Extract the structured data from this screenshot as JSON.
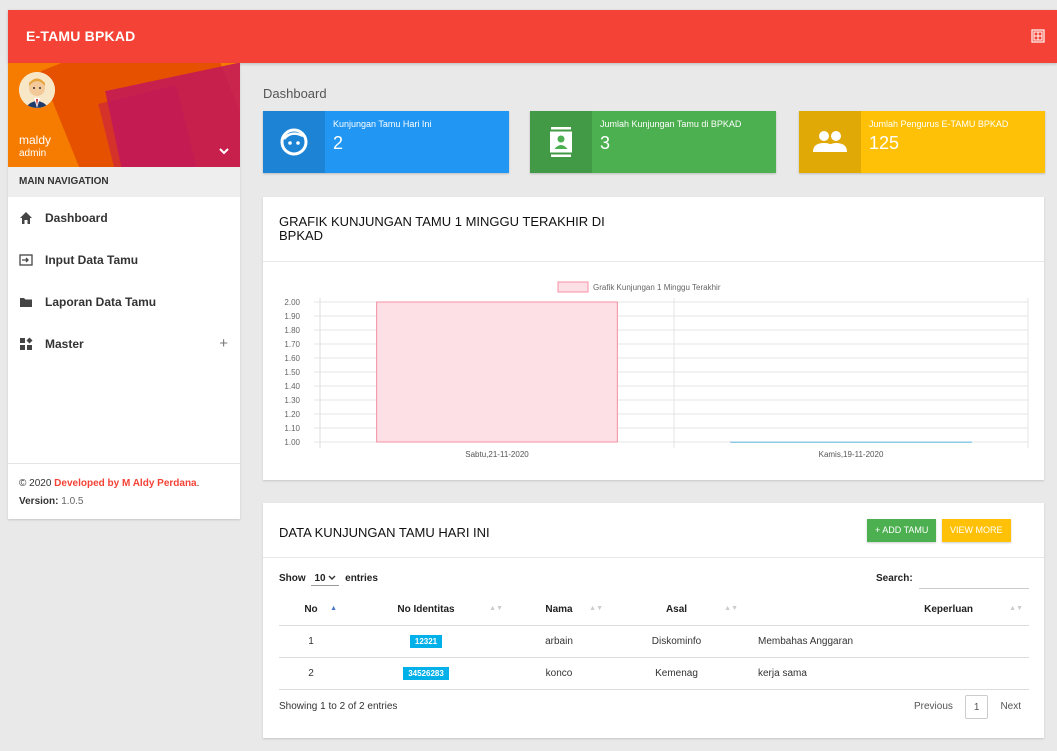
{
  "topbar": {
    "brand": "E-TAMU BPKAD"
  },
  "sidebar": {
    "user": {
      "name": "maldy",
      "role": "admin"
    },
    "nav_header": "MAIN NAVIGATION",
    "items": [
      {
        "label": "Dashboard",
        "icon": "home-icon"
      },
      {
        "label": "Input Data Tamu",
        "icon": "input-icon"
      },
      {
        "label": "Laporan Data Tamu",
        "icon": "folder-icon"
      },
      {
        "label": "Master",
        "icon": "widgets-icon"
      }
    ],
    "master_expand": "+",
    "footer": {
      "copyright": "© 2020 ",
      "developer": "Developed by M Aldy Perdana",
      "period": ".",
      "version_label": "Version:",
      "version": " 1.0.5"
    }
  },
  "page": {
    "title": "Dashboard"
  },
  "info_boxes": [
    {
      "text": "Kunjungan Tamu Hari Ini",
      "value": "2",
      "color": "#2196f3",
      "icon": "face-icon"
    },
    {
      "text": "Jumlah Kunjungan Tamu di BPKAD",
      "value": "3",
      "color": "#4caf50",
      "icon": "contact-icon"
    },
    {
      "text": "Jumlah Pengurus E-TAMU BPKAD",
      "value": "125",
      "color": "#ffc107",
      "icon": "people-icon"
    }
  ],
  "chart_card": {
    "title": "GRAFIK KUNJUNGAN TAMU 1 MINGGU TERAKHIR DI BPKAD"
  },
  "chart_data": {
    "type": "bar",
    "title": "",
    "legend": "Grafik Kunjungan 1 Minggu Terakhir",
    "legend_position": "top",
    "categories": [
      "Sabtu,21-11-2020",
      "Kamis,19-11-2020"
    ],
    "values": [
      2,
      1
    ],
    "ylim": [
      1,
      2
    ],
    "yticks": [
      "2.00",
      "1.90",
      "1.80",
      "1.70",
      "1.60",
      "1.50",
      "1.40",
      "1.30",
      "1.20",
      "1.10",
      "1.00"
    ],
    "grid": true,
    "bar_fill": "#fde0e6",
    "bar_stroke": "#f48fa4",
    "second_bar_stroke": "#8ecae6"
  },
  "table_card": {
    "title": "DATA KUNJUNGAN TAMU HARI INI",
    "add_label": "+ ADD TAMU",
    "more_label": "VIEW MORE",
    "show_label": "Show",
    "entries_value": "10",
    "entries_label": "entries",
    "search_label": "Search:",
    "columns": [
      "No",
      "No Identitas",
      "Nama",
      "Asal",
      "Keperluan"
    ],
    "rows": [
      {
        "no": "1",
        "identitas": "12321",
        "nama": "arbain",
        "asal": "Diskominfo",
        "keperluan": "Membahas Anggaran"
      },
      {
        "no": "2",
        "identitas": "34526283",
        "nama": "konco",
        "asal": "Kemenag",
        "keperluan": "kerja sama"
      }
    ],
    "info": "Showing 1 to 2 of 2 entries",
    "prev": "Previous",
    "page": "1",
    "next": "Next"
  }
}
